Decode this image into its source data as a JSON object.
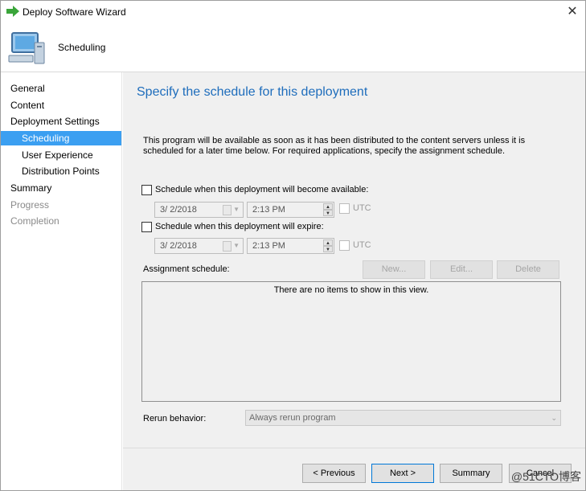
{
  "window": {
    "title": "Deploy Software Wizard",
    "close_glyph": "✕"
  },
  "header": {
    "title": "Scheduling",
    "icon": "computer-icon"
  },
  "nav": {
    "general": "General",
    "content": "Content",
    "deployment_settings": "Deployment Settings",
    "scheduling": "Scheduling",
    "user_experience": "User Experience",
    "distribution_points": "Distribution Points",
    "summary": "Summary",
    "progress": "Progress",
    "completion": "Completion"
  },
  "main": {
    "title": "Specify the schedule for this deployment",
    "description": "This program will be available as soon as it has been distributed to the content servers unless it is scheduled for a later time below. For required applications, specify the assignment schedule.",
    "available": {
      "label": "Schedule when this deployment will become available:",
      "date": "3/  2/2018",
      "time": "2:13 PM",
      "utc": "UTC"
    },
    "expire": {
      "label": "Schedule when this deployment will expire:",
      "date": "3/  2/2018",
      "time": "2:13 PM",
      "utc": "UTC"
    },
    "assignment": {
      "label": "Assignment schedule:",
      "new": "New...",
      "edit": "Edit...",
      "delete": "Delete",
      "empty": "There are no items to show in this view."
    },
    "rerun": {
      "label": "Rerun behavior:",
      "value": "Always rerun program"
    }
  },
  "buttons": {
    "previous": "< Previous",
    "next": "Next >",
    "summary": "Summary",
    "cancel": "Cancel"
  },
  "watermark": "@51CTO博客",
  "colors": {
    "accent": "#1e6dbc",
    "nav_active": "#3b9ff1"
  }
}
